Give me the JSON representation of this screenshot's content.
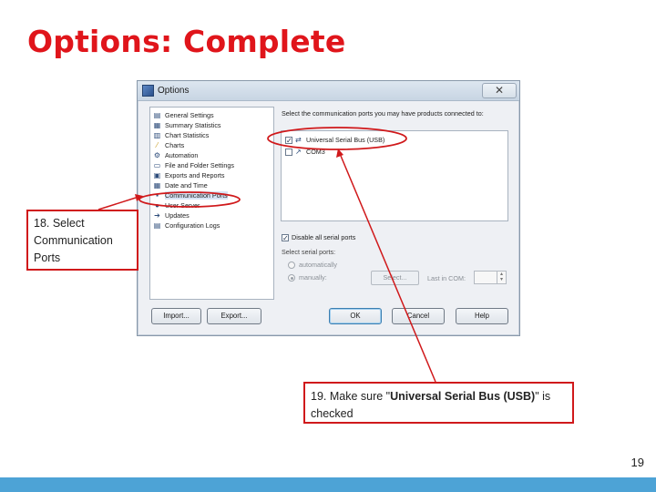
{
  "slide": {
    "title": "Options: Complete",
    "page_number": "19",
    "colors": {
      "title_red": "#e0151b",
      "callout_red": "#d0191b",
      "footer_blue": "#4da3d6"
    }
  },
  "dialog": {
    "title": "Options",
    "close_glyph": "✕",
    "tree_items": [
      {
        "label": "General Settings",
        "icon": "settings-icon"
      },
      {
        "label": "Summary Statistics",
        "icon": "stats-icon"
      },
      {
        "label": "Chart Statistics",
        "icon": "chart-stats-icon"
      },
      {
        "label": "Charts",
        "icon": "charts-icon"
      },
      {
        "label": "Automation",
        "icon": "automation-icon"
      },
      {
        "label": "File and Folder Settings",
        "icon": "folder-icon"
      },
      {
        "label": "Exports and Reports",
        "icon": "export-icon"
      },
      {
        "label": "Date and Time",
        "icon": "calendar-icon"
      },
      {
        "label": "Communication Ports",
        "icon": "port-icon"
      },
      {
        "label": "User Server",
        "icon": "server-icon"
      },
      {
        "label": "Updates",
        "icon": "update-arrow-icon"
      },
      {
        "label": "Configuration Logs",
        "icon": "log-icon"
      }
    ],
    "selected_tree_item": "Communication Ports",
    "ports_header": "Select the communication ports you may have products connected to:",
    "ports": [
      {
        "label": "Universal Serial Bus (USB)",
        "checked": true,
        "icon": "usb-icon"
      },
      {
        "label": "COM3",
        "checked": false,
        "icon": "serial-port-icon"
      }
    ],
    "disable_serial": {
      "label": "Disable all serial ports",
      "checked": true
    },
    "select_serial_label": "Select serial ports:",
    "radio_auto": "automatically",
    "radio_manual": "manually:",
    "select_button": "Select...",
    "com_label": "Last in COM:",
    "buttons": {
      "import": "Import...",
      "export": "Export...",
      "ok": "OK",
      "cancel": "Cancel",
      "help": "Help"
    }
  },
  "annotations": {
    "step18": "18. Select Communication Ports",
    "step19_prefix": "19. Make sure \"",
    "step19_bold": "Universal Serial Bus (USB)",
    "step19_suffix": "\" is checked"
  }
}
